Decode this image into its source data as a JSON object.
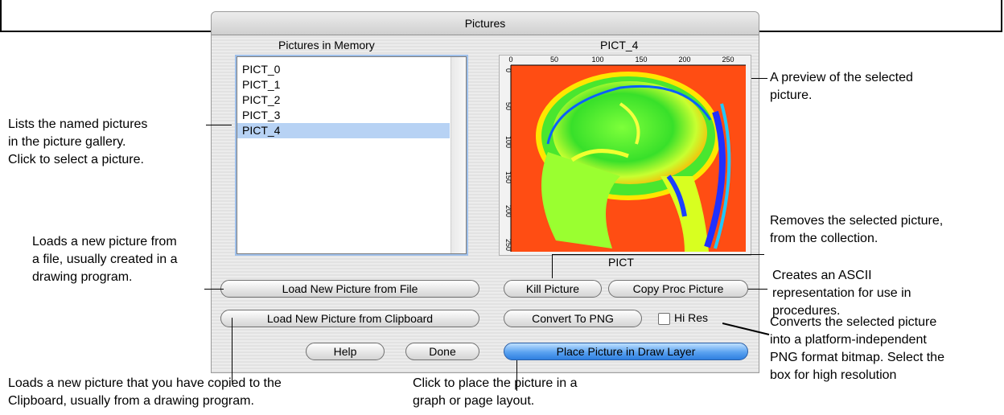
{
  "window": {
    "title": "Pictures"
  },
  "list": {
    "header": "Pictures in Memory",
    "items": [
      "PICT_0",
      "PICT_1",
      "PICT_2",
      "PICT_3",
      "PICT_4"
    ],
    "selected_index": 4
  },
  "preview": {
    "title": "PICT_4",
    "x_ticks": [
      "0",
      "50",
      "100",
      "150",
      "200",
      "250"
    ],
    "y_ticks": [
      "0",
      "50",
      "100",
      "150",
      "200",
      "250"
    ],
    "type_label": "PICT"
  },
  "buttons": {
    "load_file": "Load New Picture from File",
    "load_clipboard": "Load New Picture from Clipboard",
    "help": "Help",
    "done": "Done",
    "kill": "Kill Picture",
    "copy_proc": "Copy Proc Picture",
    "convert_png": "Convert To PNG",
    "hi_res": "Hi Res",
    "place": "Place Picture in Draw Layer"
  },
  "annotations": {
    "list_desc": [
      "Lists the named pictures",
      "in the picture gallery.",
      "Click to select a picture."
    ],
    "load_file_desc": [
      "Loads a new picture from",
      "a file, usually created in a",
      "drawing program."
    ],
    "load_clip_desc": [
      "Loads a new picture that you have copied to the",
      "Clipboard, usually from a drawing program."
    ],
    "place_desc": [
      "Click to place the picture in a",
      "graph or page layout."
    ],
    "preview_desc": [
      "A preview of the selected",
      "picture."
    ],
    "kill_desc": [
      "Removes the selected picture,",
      "from the collection."
    ],
    "copy_desc": [
      "Creates an ASCII",
      "representation for use in",
      "procedures."
    ],
    "convert_desc": [
      "Converts the selected picture",
      "into a platform-independent",
      "PNG format bitmap. Select the",
      "box for high resolution"
    ]
  },
  "colors": {
    "selection": "#b7d2f4",
    "focus_ring": "#9fc0ea",
    "default_button": "#5aa2f0"
  }
}
